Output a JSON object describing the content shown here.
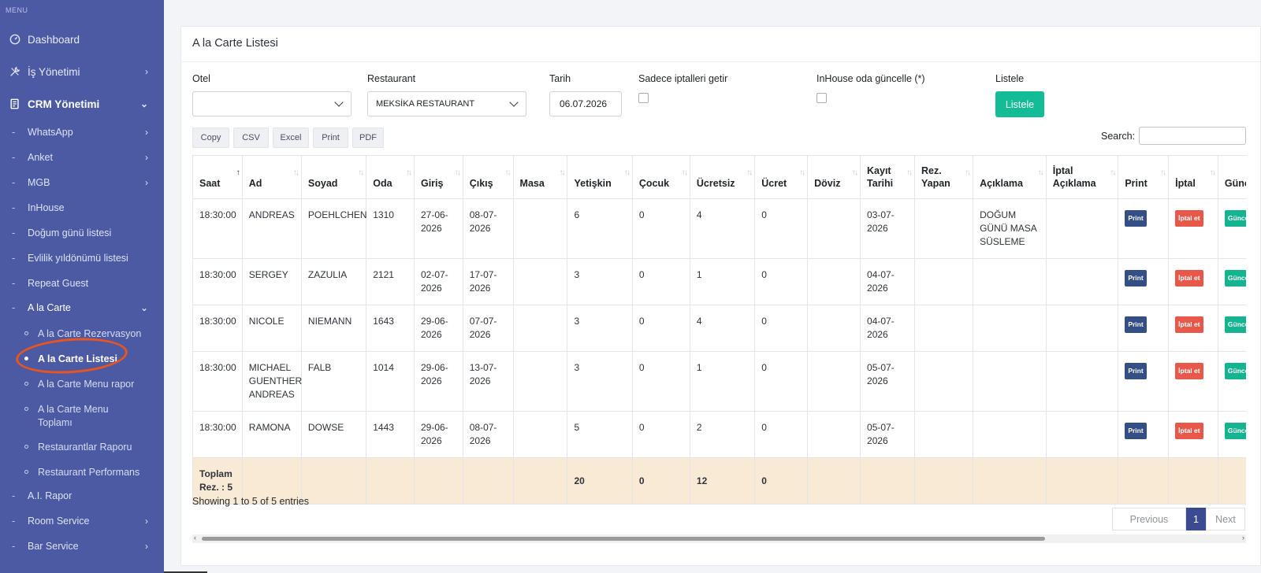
{
  "sidebar": {
    "heading": "MENU",
    "items": [
      {
        "label": "Dashboard",
        "icon": "dashboard-icon"
      },
      {
        "label": "İş Yönetimi",
        "icon": "tools-icon"
      },
      {
        "label": "CRM Yönetimi",
        "icon": "document-icon"
      }
    ],
    "crm_sub": [
      {
        "label": "WhatsApp"
      },
      {
        "label": "Anket"
      },
      {
        "label": "MGB"
      },
      {
        "label": "InHouse"
      },
      {
        "label": "Doğum günü listesi"
      },
      {
        "label": "Evlilik yıldönümü listesi"
      },
      {
        "label": "Repeat Guest"
      },
      {
        "label": "A la Carte"
      }
    ],
    "alacarte_sub": [
      {
        "label": "A la Carte Rezervasyon"
      },
      {
        "label": "A la Carte Listesi"
      },
      {
        "label": "A la Carte Menu rapor"
      },
      {
        "label": "A la Carte Menu Toplamı"
      },
      {
        "label": "Restaurantlar Raporu"
      },
      {
        "label": "Restaurant Performans"
      }
    ],
    "after_sub": [
      {
        "label": "A.I. Rapor"
      },
      {
        "label": "Room Service"
      },
      {
        "label": "Bar Service"
      }
    ]
  },
  "page": {
    "title": "A la Carte Listesi"
  },
  "filters": {
    "otel_label": "Otel",
    "otel_value": "",
    "restaurant_label": "Restaurant",
    "restaurant_value": "MEKSİKA RESTAURANT",
    "tarih_label": "Tarih",
    "tarih_value": "06.07.2026",
    "iptal_label": "Sadece iptalleri getir",
    "inhouse_label": "InHouse oda güncelle (*)",
    "listele_label": "Listele",
    "listele_button": "Listele"
  },
  "export_buttons": [
    "Copy",
    "CSV",
    "Excel",
    "Print",
    "PDF"
  ],
  "search_label": "Search:",
  "table": {
    "headers": [
      "Saat",
      "Ad",
      "Soyad",
      "Oda",
      "Giriş",
      "Çıkış",
      "Masa",
      "Yetişkin",
      "Çocuk",
      "Ücretsiz",
      "Ücret",
      "Döviz",
      "Kayıt Tarihi",
      "Rez. Yapan",
      "Açıklama",
      "İptal Açıklama",
      "Print",
      "İptal",
      "Güncelle"
    ],
    "rows": [
      {
        "saat": "18:30:00",
        "ad": "ANDREAS",
        "soyad": "POEHLCHEN",
        "oda": "1310",
        "giris": "27-06-2026",
        "cikis": "08-07-2026",
        "masa": "",
        "yetiskin": "6",
        "cocuk": "0",
        "ucretsiz": "4",
        "ucret": "0",
        "doviz": "",
        "kayit": "03-07-2026",
        "rez": "",
        "aciklama": "DOĞUM GÜNÜ MASA SÜSLEME",
        "iptal_aciklama": ""
      },
      {
        "saat": "18:30:00",
        "ad": "SERGEY",
        "soyad": "ZAZULIA",
        "oda": "2121",
        "giris": "02-07-2026",
        "cikis": "17-07-2026",
        "masa": "",
        "yetiskin": "3",
        "cocuk": "0",
        "ucretsiz": "1",
        "ucret": "0",
        "doviz": "",
        "kayit": "04-07-2026",
        "rez": "",
        "aciklama": "",
        "iptal_aciklama": ""
      },
      {
        "saat": "18:30:00",
        "ad": "NICOLE",
        "soyad": "NIEMANN",
        "oda": "1643",
        "giris": "29-06-2026",
        "cikis": "07-07-2026",
        "masa": "",
        "yetiskin": "3",
        "cocuk": "0",
        "ucretsiz": "4",
        "ucret": "0",
        "doviz": "",
        "kayit": "04-07-2026",
        "rez": "",
        "aciklama": "",
        "iptal_aciklama": ""
      },
      {
        "saat": "18:30:00",
        "ad": "MICHAEL GUENTHER ANDREAS",
        "soyad": "FALB",
        "oda": "1014",
        "giris": "29-06-2026",
        "cikis": "13-07-2026",
        "masa": "",
        "yetiskin": "3",
        "cocuk": "0",
        "ucretsiz": "1",
        "ucret": "0",
        "doviz": "",
        "kayit": "05-07-2026",
        "rez": "",
        "aciklama": "",
        "iptal_aciklama": ""
      },
      {
        "saat": "18:30:00",
        "ad": "RAMONA",
        "soyad": "DOWSE",
        "oda": "1443",
        "giris": "29-06-2026",
        "cikis": "08-07-2026",
        "masa": "",
        "yetiskin": "5",
        "cocuk": "0",
        "ucretsiz": "2",
        "ucret": "0",
        "doviz": "",
        "kayit": "05-07-2026",
        "rez": "",
        "aciklama": "",
        "iptal_aciklama": ""
      }
    ],
    "badges": {
      "print": "Print",
      "iptal": "İptal et",
      "guncelle": "Güncelle"
    },
    "footer": {
      "label": "Toplam Rez. : 5",
      "yetiskin": "20",
      "cocuk": "0",
      "ucretsiz": "12",
      "ucret": "0"
    }
  },
  "info_text": "Showing 1 to 5 of 5 entries",
  "pagination": {
    "previous": "Previous",
    "page": "1",
    "next": "Next"
  },
  "colors": {
    "sidebar": "#4b5aa3",
    "accent": "#13bc96",
    "pager_active": "#3a4b91",
    "footer_row": "#f9ead6"
  }
}
